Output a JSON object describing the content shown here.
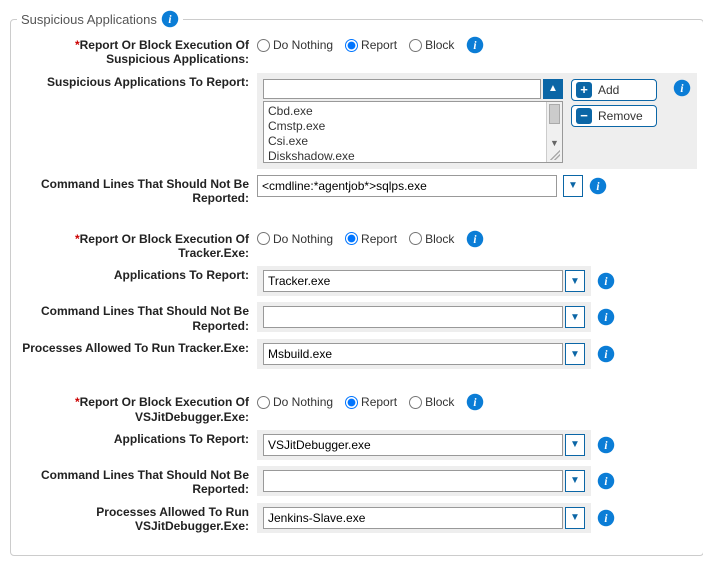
{
  "legend": "Suspicious Applications",
  "buttons": {
    "add": "Add",
    "remove": "Remove"
  },
  "radio": {
    "doNothing": "Do Nothing",
    "report": "Report",
    "block": "Block"
  },
  "sections": {
    "susp": {
      "l1": "Report Or Block Execution Of Suspicious Applications:",
      "l2": "Suspicious Applications To Report:",
      "list": [
        "Cbd.exe",
        "Cmstp.exe",
        "Csi.exe",
        "Diskshadow.exe"
      ],
      "l3a": "Command Lines That Should Not Be",
      "l3b": "Reported:",
      "cmdline_value": "<cmdline:*agentjob*>sqlps.exe"
    },
    "tracker": {
      "l1a": "Report Or Block Execution Of",
      "l1b": "Tracker.Exe:",
      "l2": "Applications To Report:",
      "v2": "Tracker.exe",
      "l3a": "Command Lines That Should Not Be",
      "l3b": "Reported:",
      "v3": "",
      "l4": "Processes Allowed To Run Tracker.Exe:",
      "v4": "Msbuild.exe"
    },
    "vsjit": {
      "l1a": "Report Or Block Execution Of",
      "l1b": "VSJitDebugger.Exe:",
      "l2": "Applications To Report:",
      "v2": "VSJitDebugger.exe",
      "l3a": "Command Lines That Should Not Be",
      "l3b": "Reported:",
      "v3": "",
      "l4a": "Processes Allowed To Run",
      "l4b": "VSJitDebugger.Exe:",
      "v4": "Jenkins-Slave.exe"
    }
  }
}
